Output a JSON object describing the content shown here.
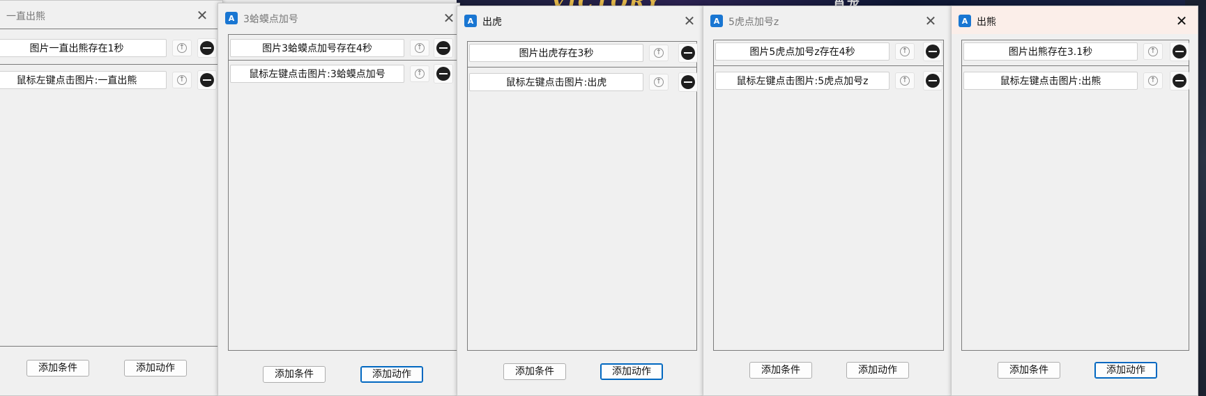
{
  "colors": {
    "accent": "#0067c0",
    "remove_icon": "#1e1e1e",
    "app_icon": "#1976d2"
  },
  "background": {
    "banner_text": "VICTORY",
    "banner_text_2": "肖龙"
  },
  "windows": [
    {
      "title": "一直出熊",
      "condition": "图片一直出熊存在1秒",
      "action": "鼠标左键点击图片:一直出熊",
      "add_condition": "添加条件",
      "add_action": "添加动作"
    },
    {
      "title": "3蛤蟆点加号",
      "condition": "图片3蛤蟆点加号存在4秒",
      "action": "鼠标左键点击图片:3蛤蟆点加号",
      "add_condition": "添加条件",
      "add_action": "添加动作"
    },
    {
      "title": "出虎",
      "condition": "图片出虎存在3秒",
      "action": "鼠标左键点击图片:出虎",
      "add_condition": "添加条件",
      "add_action": "添加动作"
    },
    {
      "title": "5虎点加号z",
      "condition": "图片5虎点加号z存在4秒",
      "action": "鼠标左键点击图片:5虎点加号z",
      "add_condition": "添加条件",
      "add_action": "添加动作"
    },
    {
      "title": "出熊",
      "condition": "图片出熊存在3.1秒",
      "action": "鼠标左键点击图片:出熊",
      "add_condition": "添加条件",
      "add_action": "添加动作"
    }
  ],
  "icons": {
    "app": "app-a-icon",
    "close": "close-icon",
    "move_up": "arrow-up-circle-icon",
    "remove": "minus-circle-icon"
  }
}
